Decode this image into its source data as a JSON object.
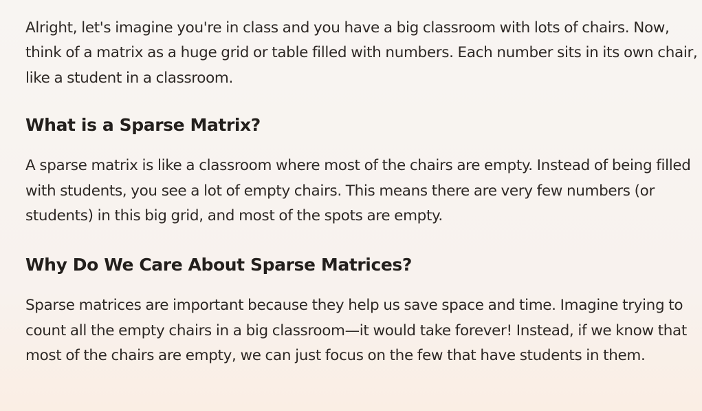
{
  "article": {
    "intro": "Alright, let's imagine you're in class and you have a big classroom with lots of chairs. Now, think of a matrix as a huge grid or table filled with numbers. Each number sits in its own chair, like a student in a classroom.",
    "sections": [
      {
        "heading": "What is a Sparse Matrix?",
        "body": "A sparse matrix is like a classroom where most of the chairs are empty. Instead of being filled with students, you see a lot of empty chairs. This means there are very few numbers (or students) in this big grid, and most of the spots are empty."
      },
      {
        "heading": "Why Do We Care About Sparse Matrices?",
        "body": "Sparse matrices are important because they help us save space and time. Imagine trying to count all the empty chairs in a big classroom—it would take forever! Instead, if we know that most of the chairs are empty, we can just focus on the few that have students in them."
      }
    ]
  }
}
